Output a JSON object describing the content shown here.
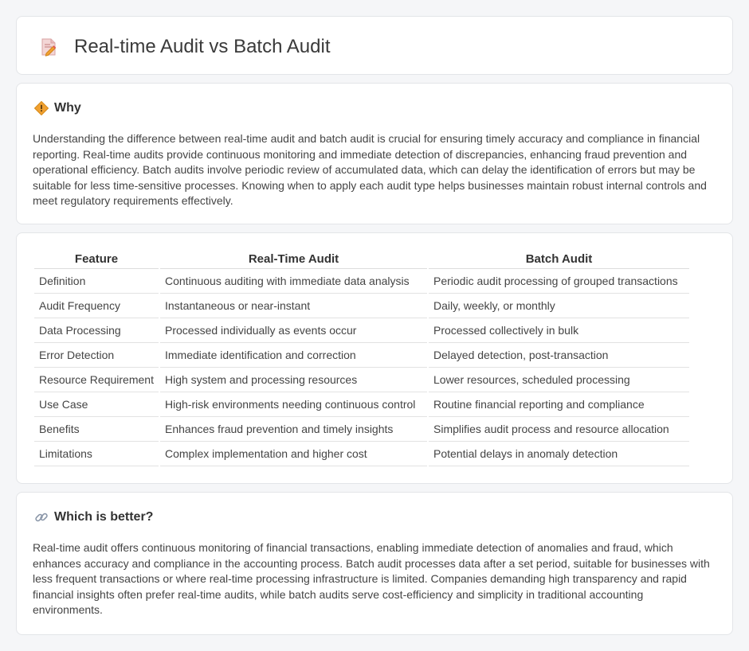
{
  "header": {
    "title": "Real-time Audit vs Batch Audit",
    "icon": "document-pencil-icon"
  },
  "why": {
    "icon": "diamond-warning-icon",
    "title": "Why",
    "body": "Understanding the difference between real-time audit and batch audit is crucial for ensuring timely accuracy and compliance in financial reporting. Real-time audits provide continuous monitoring and immediate detection of discrepancies, enhancing fraud prevention and operational efficiency. Batch audits involve periodic review of accumulated data, which can delay the identification of errors but may be suitable for less time-sensitive processes. Knowing when to apply each audit type helps businesses maintain robust internal controls and meet regulatory requirements effectively."
  },
  "table": {
    "headers": [
      "Feature",
      "Real-Time Audit",
      "Batch Audit"
    ],
    "rows": [
      [
        "Definition",
        "Continuous auditing with immediate data analysis",
        "Periodic audit processing of grouped transactions"
      ],
      [
        "Audit Frequency",
        "Instantaneous or near-instant",
        "Daily, weekly, or monthly"
      ],
      [
        "Data Processing",
        "Processed individually as events occur",
        "Processed collectively in bulk"
      ],
      [
        "Error Detection",
        "Immediate identification and correction",
        "Delayed detection, post-transaction"
      ],
      [
        "Resource Requirement",
        "High system and processing resources",
        "Lower resources, scheduled processing"
      ],
      [
        "Use Case",
        "High-risk environments needing continuous control",
        "Routine financial reporting and compliance"
      ],
      [
        "Benefits",
        "Enhances fraud prevention and timely insights",
        "Simplifies audit process and resource allocation"
      ],
      [
        "Limitations",
        "Complex implementation and higher cost",
        "Potential delays in anomaly detection"
      ]
    ]
  },
  "better": {
    "icon": "link-icon",
    "title": "Which is better?",
    "body": "Real-time audit offers continuous monitoring of financial transactions, enabling immediate detection of anomalies and fraud, which enhances accuracy and compliance in the accounting process. Batch audit processes data after a set period, suitable for businesses with less frequent transactions or where real-time processing infrastructure is limited. Companies demanding high transparency and rapid financial insights often prefer real-time audits, while batch audits serve cost-efficiency and simplicity in traditional accounting environments."
  },
  "colors": {
    "background": "#f5f6f8",
    "card": "#ffffff",
    "accent_orange": "#f0a030",
    "text": "#444444"
  }
}
